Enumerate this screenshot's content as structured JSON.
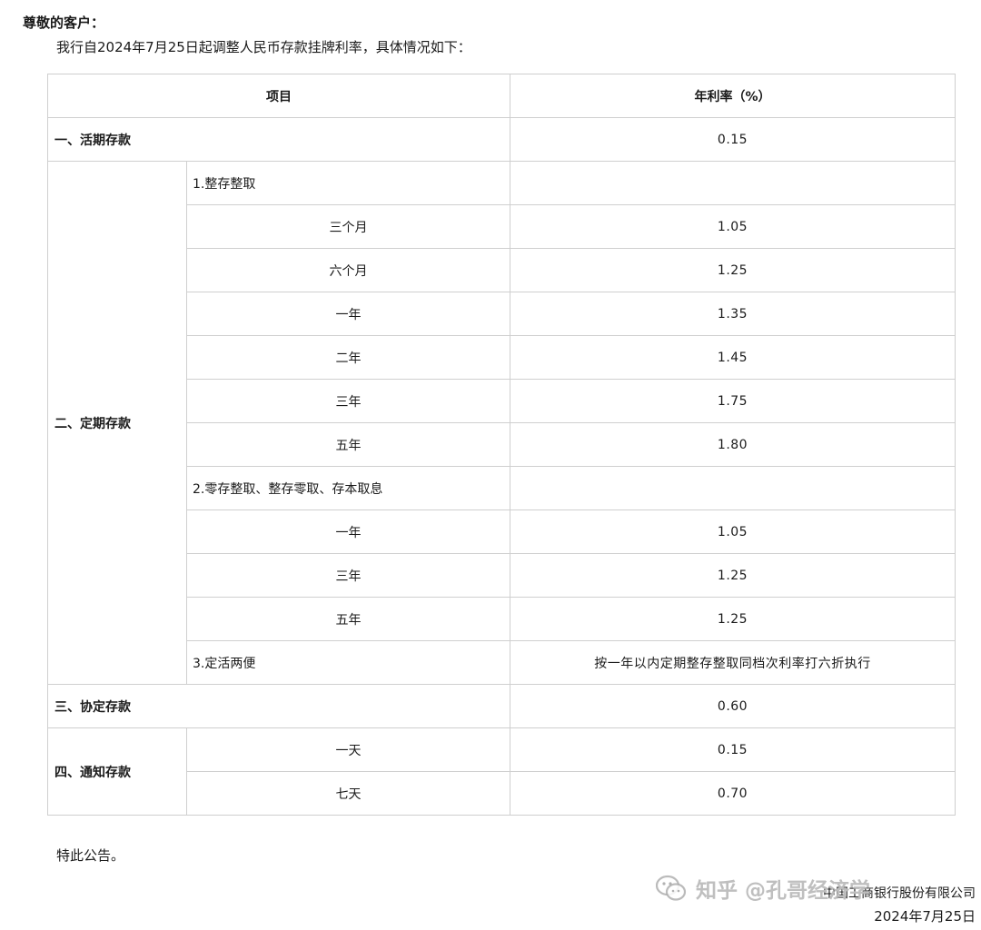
{
  "notice": {
    "greeting": "尊敬的客户：",
    "intro": "我行自2024年7月25日起调整人民币存款挂牌利率，具体情况如下：",
    "closing": "特此公告。",
    "signer": "中国工商银行股份有限公司",
    "date": "2024年7月25日"
  },
  "table": {
    "header_item": "项目",
    "header_rate": "年利率（%）",
    "demand": {
      "label": "一、活期存款",
      "rate": "0.15"
    },
    "time": {
      "label": "二、定期存款",
      "lump_sum": {
        "label": "1.整存整取",
        "rows": [
          {
            "term": "三个月",
            "rate": "1.05"
          },
          {
            "term": "六个月",
            "rate": "1.25"
          },
          {
            "term": "一年",
            "rate": "1.35"
          },
          {
            "term": "二年",
            "rate": "1.45"
          },
          {
            "term": "三年",
            "rate": "1.75"
          },
          {
            "term": "五年",
            "rate": "1.80"
          }
        ]
      },
      "installment": {
        "label": "2.零存整取、整存零取、存本取息",
        "rows": [
          {
            "term": "一年",
            "rate": "1.05"
          },
          {
            "term": "三年",
            "rate": "1.25"
          },
          {
            "term": "五年",
            "rate": "1.25"
          }
        ]
      },
      "flexible": {
        "label": "3.定活两便",
        "rate": "按一年以内定期整存整取同档次利率打六折执行"
      }
    },
    "agreement": {
      "label": "三、协定存款",
      "rate": "0.60"
    },
    "notice_deposit": {
      "label": "四、通知存款",
      "rows": [
        {
          "term": "一天",
          "rate": "0.15"
        },
        {
          "term": "七天",
          "rate": "0.70"
        }
      ]
    }
  },
  "watermark": {
    "text": "知乎 @孔哥经济学",
    "icon": "wechat-icon"
  }
}
